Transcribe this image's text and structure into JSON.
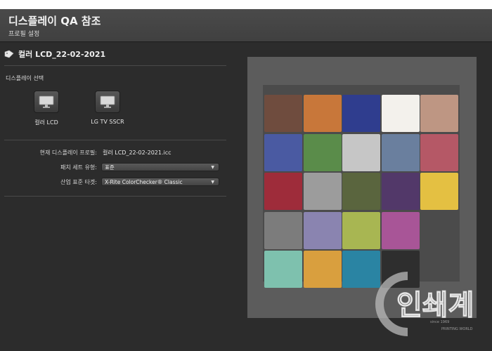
{
  "window": {
    "title": "디스플레이 QA 참조",
    "subtitle": "프로필 설정"
  },
  "profile": {
    "icon": "tag-icon",
    "name": "컬러 LCD_22-02-2021"
  },
  "display_select": {
    "title": "디스플레이 선택",
    "displays": [
      {
        "label": "컬러 LCD",
        "icon": "monitor-icon"
      },
      {
        "label": "LG TV SSCR",
        "icon": "monitor-icon"
      }
    ]
  },
  "settings": {
    "current_profile_label": "현재 디스플레이 프로필:",
    "current_profile_value": "컬러 LCD_22-02-2021.icc",
    "patch_set_label": "패치 세트 유형:",
    "patch_set_value": "표준",
    "industry_target_label": "산업 표준 타겟:",
    "industry_target_value": "X-Rite ColorChecker® Classic"
  },
  "colorchecker": {
    "name": "X-Rite ColorChecker® Classic",
    "patches": [
      [
        "#6f4c3e",
        "#c8773a",
        "#2f3d8e",
        "#f3f1ec",
        "#be9683"
      ],
      [
        "#4a5aa2",
        "#5a8c4a",
        "#c6c6c6",
        "#6a7f9e",
        "#b55866"
      ],
      [
        "#9e2c3a",
        "#9c9c9c",
        "#5a653e",
        "#523869",
        "#e4c042"
      ],
      [
        "#7c7c7c",
        "#8a84b0",
        "#a8b652",
        "#a85597",
        null
      ],
      [
        "#7ec1ae",
        "#d99f3e",
        "#2a84a3",
        "#2e2e2e",
        null
      ]
    ]
  },
  "watermark": {
    "text": "인쇄계",
    "sub": "since 1969",
    "brand": "PRINTING WORLD"
  }
}
